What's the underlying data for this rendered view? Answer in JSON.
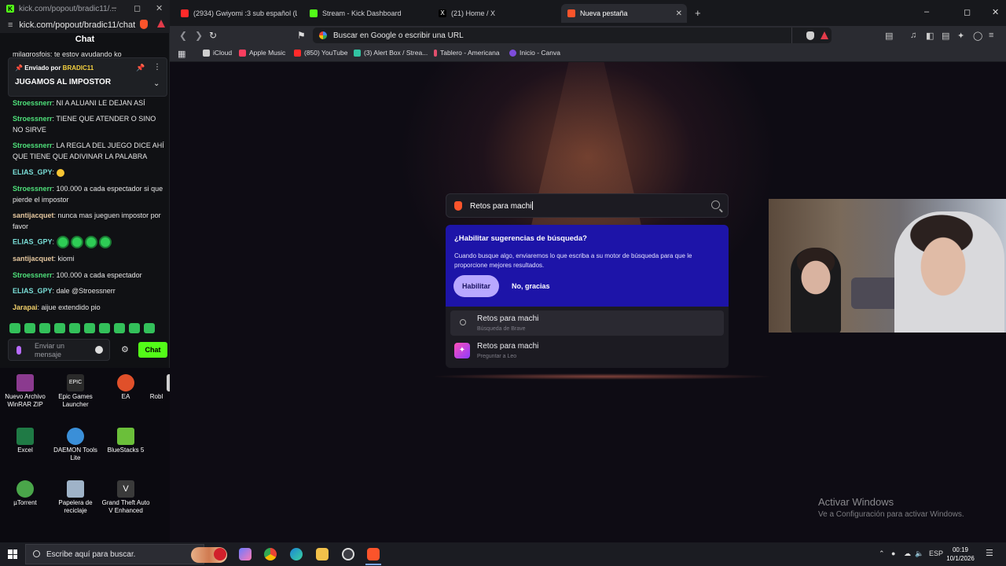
{
  "popout": {
    "title": "kick.com/popout/bradic11/...",
    "url": "kick.com/popout/bradic11/chat",
    "chat_header": "Chat",
    "pinned": {
      "by_label": "Enviado por",
      "by_user": "BRADIC11",
      "title": "JUGAMOS AL IMPOSTOR"
    },
    "top_partial_msg": "milagrosfois: te estoy avudando ko",
    "messages": [
      {
        "user": "Stroessnerr",
        "text": "NI A ALUANI LE DEJAN ASÍ"
      },
      {
        "user": "Stroessnerr",
        "text": "TIENE QUE ATENDER O SINO NO SIRVE"
      },
      {
        "user": "Stroessnerr",
        "text": "LA REGLA DEL JUEGO DICE AHÍ QUE TIENE QUE ADIVINAR LA PALABRA"
      },
      {
        "user": "ELIAS_GPY",
        "text": ""
      },
      {
        "user": "Stroessnerr",
        "text": "100.000 a cada espectador si que pierde el impostor"
      },
      {
        "user": "santijacquet",
        "text": "nunca mas jueguen impostor por favor"
      },
      {
        "user": "ELIAS_GPY",
        "text": ""
      },
      {
        "user": "santijacquet",
        "text": "kiomi"
      },
      {
        "user": "Stroessnerr",
        "text": "100.000 a cada espectador"
      },
      {
        "user": "ELIAS_GPY",
        "text": "dale @Stroessnerr"
      },
      {
        "user": "Jarapai",
        "text": "aijue extendido pio"
      }
    ],
    "input_placeholder": "Enviar un mensaje",
    "send_label": "Chat"
  },
  "desktop_icons": [
    {
      "label": "Nuevo Archivo WinRAR ZIP",
      "color": "#8b3a8f"
    },
    {
      "label": "Epic Games Launcher",
      "color": "#2a2a2a"
    },
    {
      "label": "EA",
      "color": "#e0502a"
    },
    {
      "label": "Robl",
      "color": "#cfcfcf"
    },
    {
      "label": "Excel",
      "color": "#1f7a45"
    },
    {
      "label": "DAEMON Tools Lite",
      "color": "#3a8fd8"
    },
    {
      "label": "BlueStacks 5",
      "color": "#6bbf3a"
    },
    {
      "label": "µTorrent",
      "color": "#4aa64a"
    },
    {
      "label": "Papelera de reciclaje",
      "color": "#9fb3c8"
    },
    {
      "label": "Grand Theft Auto V Enhanced",
      "color": "#3a3a3a"
    }
  ],
  "browser": {
    "tabs": [
      {
        "label": "(2934) Gwiyomi :3 sub español (LEER",
        "color": "#ff2a2a"
      },
      {
        "label": "Stream - Kick Dashboard",
        "color": "#53fc18"
      },
      {
        "label": "(21) Home / X",
        "color": "#000000"
      },
      {
        "label": "Nueva pestaña",
        "color": "#fb542b"
      }
    ],
    "omnibox_placeholder": "Buscar en Google o escribir una URL",
    "bookmarks": [
      {
        "label": "iCloud",
        "color": "#cfcfcf"
      },
      {
        "label": "Apple Music",
        "color": "#fa3e5f"
      },
      {
        "label": "(850) YouTube",
        "color": "#ff2a2a"
      },
      {
        "label": "(3) Alert Box / Strea...",
        "color": "#31c3a2"
      },
      {
        "label": "Tablero - Americana",
        "color": "#e14f6d"
      },
      {
        "label": "Inicio - Canva",
        "color": "#7d4cdb"
      }
    ]
  },
  "newtab": {
    "search_query": "Retos para machi",
    "promo_title": "¿Habilitar sugerencias de búsqueda?",
    "promo_body": "Cuando busque algo, enviaremos lo que escriba a su motor de búsqueda para que le proporcione mejores resultados.",
    "enable_label": "Habilitar",
    "decline_label": "No, gracias",
    "suggestions": [
      {
        "title": "Retos para machi",
        "subtitle": "Búsqueda de Brave"
      },
      {
        "title": "Retos para machi",
        "subtitle": "Preguntar a Leo"
      }
    ]
  },
  "watermark": {
    "line1": "Activar Windows",
    "line2": "Ve a Configuración para activar Windows."
  },
  "taskbar": {
    "search_placeholder": "Escribe aquí para buscar.",
    "lang": "ESP",
    "time": "00:19",
    "date": "10/1/2026",
    "apps": [
      {
        "name": "opera-gx-app",
        "color": "#d1202b"
      },
      {
        "name": "copilot-app",
        "color": "#6a7bff"
      },
      {
        "name": "chrome-app",
        "color": "#34a853"
      },
      {
        "name": "edge-app",
        "color": "#1b86d6"
      },
      {
        "name": "file-explorer-app",
        "color": "#f2c14a"
      },
      {
        "name": "obs-app",
        "color": "#3d3d44"
      },
      {
        "name": "brave-app",
        "color": "#fb542b"
      }
    ]
  }
}
